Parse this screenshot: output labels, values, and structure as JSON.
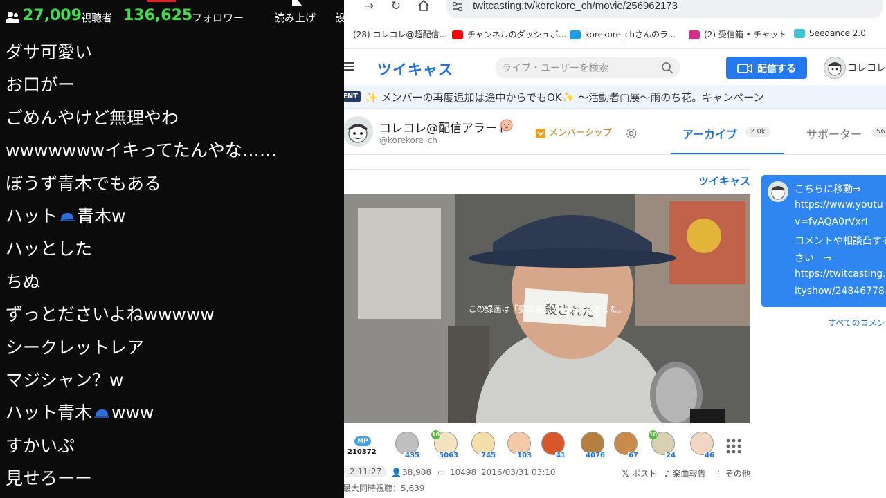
{
  "overlay": {
    "viewers_count": "27,009",
    "viewers_label": "視聴者",
    "followers_count": "136,625",
    "followers_label": "フォロワー",
    "tts_label": "読み上げ",
    "settings_label": "設",
    "comments": [
      {
        "text": "ダサ可愛い"
      },
      {
        "text": "お口がー"
      },
      {
        "text": "ごめんやけど無理やわ"
      },
      {
        "text": "wwwwwwwイキってたんやな……"
      },
      {
        "text": "ぼうず青木でもある"
      },
      {
        "text": "ハット",
        "icon": "cap-icon",
        "after": "青木w"
      },
      {
        "text": "ハッとした"
      },
      {
        "text": "ちぬ"
      },
      {
        "text": "ずっとださいよねwwwww"
      },
      {
        "text": "シークレットレア"
      },
      {
        "text": "マジシャン？w"
      },
      {
        "text": "ハット青木",
        "icon": "cap-icon",
        "after": "www"
      },
      {
        "text": "すかいぷ"
      },
      {
        "text": "見せろーー"
      }
    ],
    "colors": {
      "background": "#0b0b0b",
      "numbers": "#3ee04a"
    }
  },
  "browser": {
    "url": "twitcasting.tv/korekore_ch/movie/256962173",
    "bookmarks": [
      {
        "label": "(28) コレコレ@超配信...",
        "icon": "tab-favicon"
      },
      {
        "label": "チャンネルのダッシュボ...",
        "icon": "youtube-icon"
      },
      {
        "label": "korekore_chさんのラ...",
        "icon": "twitcasting-icon"
      },
      {
        "label": "(2) 受信箱 • チャット",
        "icon": "instagram-icon"
      },
      {
        "label": "Seedance 2.0",
        "icon": "seedance-icon"
      }
    ]
  },
  "site": {
    "logo": "ツイキャス",
    "search_placeholder": "ライブ・ユーザーを検索",
    "broadcast_label": "配信する",
    "user_name": "コレコレ@",
    "banner_tag": "ENT",
    "banner_text": "✨ メンバーの再度追加は途中からでもOK✨ ～活動者▢展～雨のち花。キャンペーン",
    "channel": {
      "name": "コレコレ@配信アラート",
      "handle": "@korekore_ch",
      "membership_label": "メンバーシップ",
      "tab_archive": "アーカイブ",
      "tab_archive_count": "2.0k",
      "tab_supporter": "サポーター",
      "tab_supporter_count": "56"
    },
    "player": {
      "bar_text": "ツイキャス",
      "deleted_message": "この録画は「夢の島」で削除されました。",
      "paper_text": "殺された"
    },
    "gifts": {
      "mp_badge": "MP",
      "mp_count": "210372",
      "items": [
        {
          "icon": "disc-gift-icon",
          "count": "435"
        },
        {
          "icon": "scroll-gift-icon",
          "count": "5063",
          "level": "10"
        },
        {
          "icon": "tea-gift-icon",
          "count": "745"
        },
        {
          "icon": "clap-gift-icon",
          "count": "103"
        },
        {
          "icon": "fireworks-gift-icon",
          "count": "41"
        },
        {
          "icon": "almond-gift-icon",
          "count": "4076"
        },
        {
          "icon": "mushroom-gift-icon",
          "count": "67"
        },
        {
          "icon": "paper-stack-gift-icon",
          "count": "24",
          "level": "10"
        },
        {
          "icon": "face-gift-icon",
          "count": "46"
        }
      ]
    },
    "meta": {
      "duration": "2:11:27",
      "views": "38,908",
      "comments": "10498",
      "date": "2016/03/31 03:10",
      "peak": "最大同時視聴：5,639",
      "post_label": "ポスト",
      "music_report_label": "楽曲報告",
      "more_label": "その他"
    },
    "side_comment": {
      "lines": [
        "こちらに移動⇒",
        "https://www.youtu",
        "v=fvAQA0rVxrI",
        "コメントや相談凸する",
        "さい　⇒",
        "https://twitcasting.",
        "ityshow/24846778"
      ],
      "see_all": "すべてのコメン"
    },
    "colors": {
      "brand_blue": "#1f6fe6",
      "button_blue": "#2478f0",
      "membership_orange": "#e07b13"
    }
  }
}
